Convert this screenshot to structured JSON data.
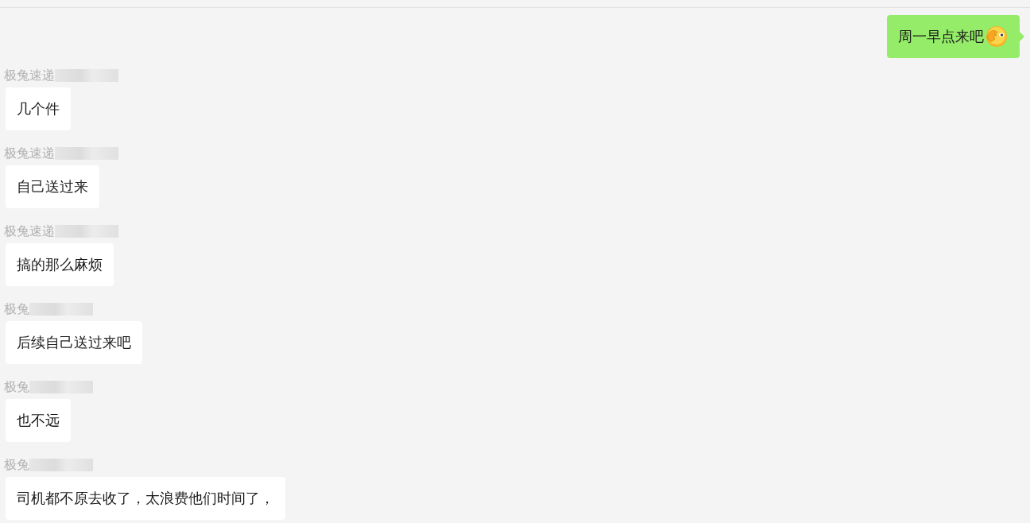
{
  "messages": [
    {
      "kind": "sent",
      "text": "周一早点来吧",
      "emoji": true
    },
    {
      "kind": "received",
      "sender": "极兔速递",
      "text": "几个件"
    },
    {
      "kind": "received",
      "sender": "极兔速递",
      "text": "自己送过来"
    },
    {
      "kind": "received",
      "sender": "极兔速递",
      "text": "搞的那么麻烦"
    },
    {
      "kind": "received",
      "sender": "极兔",
      "text": "后续自己送过来吧"
    },
    {
      "kind": "received",
      "sender": "极兔",
      "text": "也不远"
    },
    {
      "kind": "received",
      "sender": "极兔",
      "text": "司机都不原去收了，太浪费他们时间了，"
    }
  ]
}
